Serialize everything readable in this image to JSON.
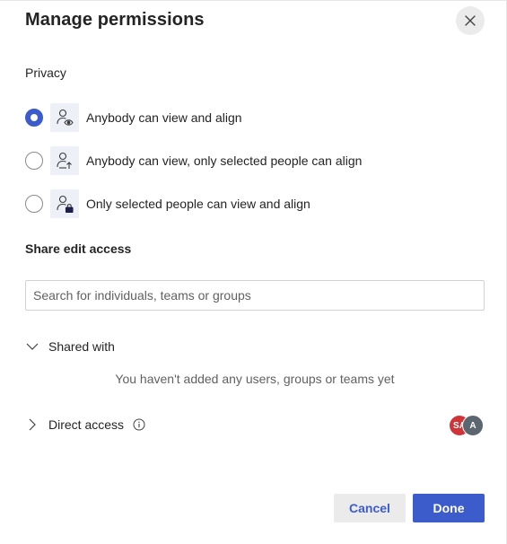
{
  "dialog": {
    "title": "Manage permissions",
    "close_icon": "close-icon"
  },
  "privacy": {
    "heading": "Privacy",
    "options": [
      {
        "label": "Anybody can view and align",
        "icon": "person-eye-icon",
        "selected": true
      },
      {
        "label": "Anybody can view, only selected people can align",
        "icon": "person-arrow-icon",
        "selected": false
      },
      {
        "label": "Only selected people can view and align",
        "icon": "person-lock-icon",
        "selected": false
      }
    ]
  },
  "share": {
    "heading": "Share edit access",
    "search_placeholder": "Search for individuals, teams or groups",
    "search_value": ""
  },
  "shared_with": {
    "label": "Shared with",
    "expanded": true,
    "empty_message": "You haven't added any users, groups or teams yet"
  },
  "direct_access": {
    "label": "Direct access",
    "expanded": false,
    "info_icon": "info-icon",
    "avatars": [
      {
        "initials": "SA",
        "color": "#d13438"
      },
      {
        "initials": "A",
        "color": "#5c6670"
      }
    ]
  },
  "actions": {
    "cancel_label": "Cancel",
    "done_label": "Done"
  },
  "colors": {
    "accent": "#3d5ccc",
    "icon_bg": "#edf0f7"
  }
}
